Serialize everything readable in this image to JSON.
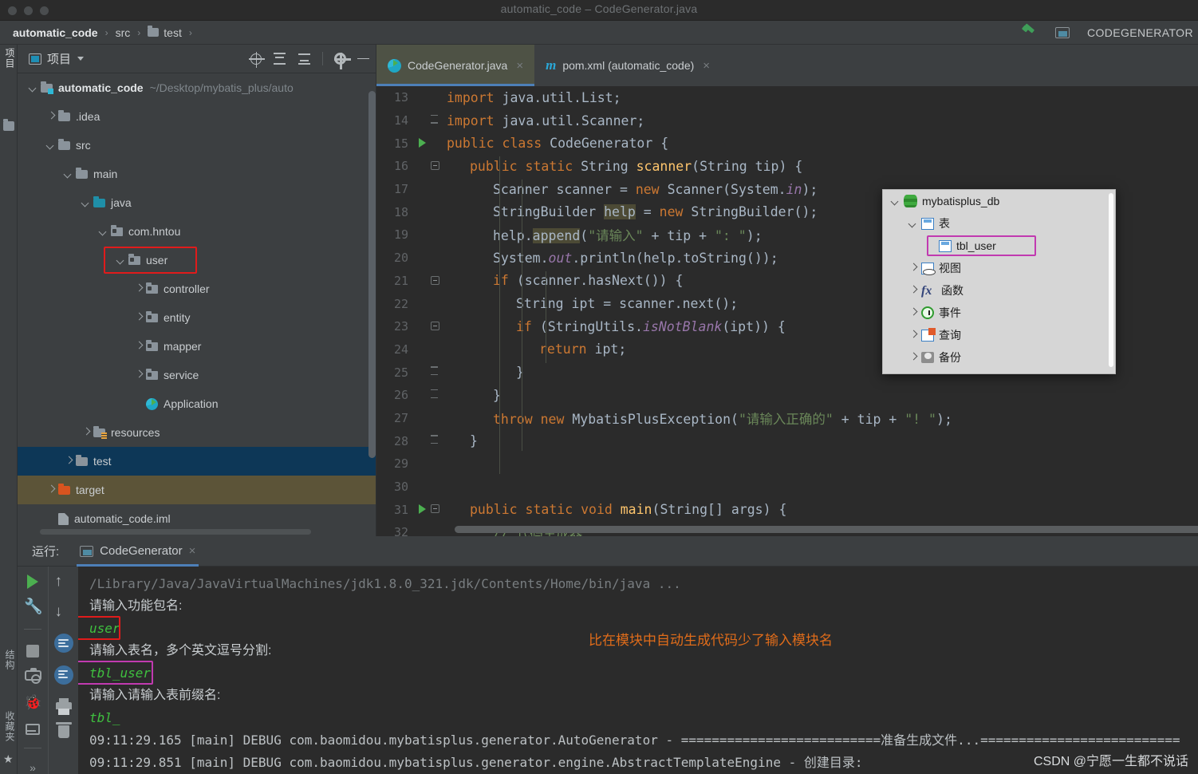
{
  "window": {
    "title": "automatic_code – CodeGenerator.java"
  },
  "navbar": {
    "crumbs": [
      "automatic_code",
      "src",
      "test"
    ],
    "separator": "›",
    "run_config_name": "CODEGENERATOR"
  },
  "left_strip": {
    "project": "项目",
    "structure": "结构",
    "favorites": "收藏夹"
  },
  "project_panel": {
    "title": "项目",
    "tree": [
      {
        "indent": 0,
        "arrow": "down",
        "icon": "folder-module",
        "label": "automatic_code",
        "bold": true,
        "path": "~/Desktop/mybatis_plus/auto"
      },
      {
        "indent": 1,
        "arrow": "right",
        "icon": "folder",
        "label": ".idea"
      },
      {
        "indent": 1,
        "arrow": "down",
        "icon": "folder",
        "label": "src"
      },
      {
        "indent": 2,
        "arrow": "down",
        "icon": "folder",
        "label": "main"
      },
      {
        "indent": 3,
        "arrow": "down",
        "icon": "folder-source",
        "label": "java"
      },
      {
        "indent": 4,
        "arrow": "down",
        "icon": "package",
        "label": "com.hntou"
      },
      {
        "indent": 5,
        "arrow": "down",
        "icon": "package",
        "label": "user",
        "highlight": "red"
      },
      {
        "indent": 6,
        "arrow": "right",
        "icon": "package",
        "label": "controller"
      },
      {
        "indent": 6,
        "arrow": "right",
        "icon": "package",
        "label": "entity"
      },
      {
        "indent": 6,
        "arrow": "right",
        "icon": "package",
        "label": "mapper"
      },
      {
        "indent": 6,
        "arrow": "right",
        "icon": "package",
        "label": "service"
      },
      {
        "indent": 6,
        "arrow": "none",
        "icon": "java-class",
        "label": "Application"
      },
      {
        "indent": 3,
        "arrow": "right",
        "icon": "folder-res",
        "label": "resources"
      },
      {
        "indent": 2,
        "arrow": "right",
        "icon": "folder",
        "label": "test",
        "selected": "blue"
      },
      {
        "indent": 1,
        "arrow": "right",
        "icon": "folder-orange",
        "label": "target",
        "selected": "khaki"
      },
      {
        "indent": 1,
        "arrow": "none",
        "icon": "iml-file",
        "label": "automatic_code.iml"
      }
    ]
  },
  "editor": {
    "tabs": [
      {
        "label": "CodeGenerator.java",
        "icon": "java-class-icon",
        "active": true,
        "close": "×"
      },
      {
        "label": "pom.xml (automatic_code)",
        "icon": "maven-icon",
        "active": false,
        "close": "×"
      }
    ],
    "first_line_number": 13,
    "lines": [
      {
        "n": 13,
        "indent": 0,
        "marker": "",
        "fold": "",
        "tokens": [
          [
            "k",
            "import"
          ],
          [
            "id",
            " java.util.List;"
          ]
        ]
      },
      {
        "n": 14,
        "indent": 0,
        "marker": "",
        "fold": "brace",
        "tokens": [
          [
            "k",
            "import"
          ],
          [
            "id",
            " java.util.Scanner;"
          ]
        ]
      },
      {
        "n": 15,
        "indent": 0,
        "marker": "run",
        "fold": "",
        "tokens": [
          [
            "k",
            "public class "
          ],
          [
            "id",
            "CodeGenerator "
          ],
          [
            "br",
            "{"
          ]
        ]
      },
      {
        "n": 16,
        "indent": 1,
        "marker": "",
        "fold": "minus",
        "tokens": [
          [
            "k",
            "public static "
          ],
          [
            "id",
            "String "
          ],
          [
            "fn",
            "scanner"
          ],
          [
            "br",
            "("
          ],
          [
            "id",
            "String tip"
          ],
          [
            "br",
            ") {"
          ]
        ]
      },
      {
        "n": 17,
        "indent": 2,
        "marker": "",
        "fold": "",
        "tokens": [
          [
            "id",
            "Scanner scanner = "
          ],
          [
            "k",
            "new "
          ],
          [
            "id",
            "Scanner"
          ],
          [
            "br",
            "("
          ],
          [
            "id",
            "System."
          ],
          [
            "st",
            "in"
          ],
          [
            "br",
            ")"
          ],
          [
            "id",
            ";"
          ]
        ]
      },
      {
        "n": 18,
        "indent": 2,
        "marker": "",
        "fold": "",
        "tokens": [
          [
            "id",
            "StringBuilder "
          ],
          [
            "hl",
            "help"
          ],
          [
            "id",
            " = "
          ],
          [
            "k",
            "new "
          ],
          [
            "id",
            "StringBuilder"
          ],
          [
            "br",
            "()"
          ],
          [
            "id",
            ";"
          ]
        ]
      },
      {
        "n": 19,
        "indent": 2,
        "marker": "",
        "fold": "",
        "tokens": [
          [
            "id",
            "help."
          ],
          [
            "hl",
            "append"
          ],
          [
            "br",
            "("
          ],
          [
            "s",
            "\"请输入\""
          ],
          [
            "id",
            " + tip + "
          ],
          [
            "s",
            "\": \""
          ],
          [
            "br",
            ")"
          ],
          [
            "id",
            ";"
          ]
        ]
      },
      {
        "n": 20,
        "indent": 2,
        "marker": "",
        "fold": "",
        "tokens": [
          [
            "id",
            "System."
          ],
          [
            "st",
            "out"
          ],
          [
            "id",
            ".println"
          ],
          [
            "br",
            "("
          ],
          [
            "id",
            "help.toString"
          ],
          [
            "br",
            "())"
          ],
          [
            "id",
            ";"
          ]
        ]
      },
      {
        "n": 21,
        "indent": 2,
        "marker": "",
        "fold": "minus",
        "tokens": [
          [
            "k",
            "if "
          ],
          [
            "br",
            "("
          ],
          [
            "id",
            "scanner.hasNext"
          ],
          [
            "br",
            "()) {"
          ]
        ]
      },
      {
        "n": 22,
        "indent": 3,
        "marker": "",
        "fold": "",
        "tokens": [
          [
            "id",
            "String ipt = scanner.next"
          ],
          [
            "br",
            "()"
          ],
          [
            "id",
            ";"
          ]
        ]
      },
      {
        "n": 23,
        "indent": 3,
        "marker": "",
        "fold": "minus",
        "tokens": [
          [
            "k",
            "if "
          ],
          [
            "br",
            "("
          ],
          [
            "id",
            "StringUtils."
          ],
          [
            "st",
            "isNotBlank"
          ],
          [
            "br",
            "("
          ],
          [
            "id",
            "ipt"
          ],
          [
            "br",
            ")) {"
          ]
        ]
      },
      {
        "n": 24,
        "indent": 4,
        "marker": "",
        "fold": "",
        "tokens": [
          [
            "k",
            "return "
          ],
          [
            "id",
            "ipt;"
          ]
        ]
      },
      {
        "n": 25,
        "indent": 3,
        "marker": "",
        "fold": "brace",
        "tokens": [
          [
            "br",
            "}"
          ]
        ]
      },
      {
        "n": 26,
        "indent": 2,
        "marker": "",
        "fold": "brace",
        "tokens": [
          [
            "br",
            "}"
          ]
        ]
      },
      {
        "n": 27,
        "indent": 2,
        "marker": "",
        "fold": "",
        "tokens": [
          [
            "k",
            "throw new "
          ],
          [
            "id",
            "MybatisPlusException"
          ],
          [
            "br",
            "("
          ],
          [
            "s",
            "\"请输入正确的\""
          ],
          [
            "id",
            " + tip + "
          ],
          [
            "s",
            "\"! \""
          ],
          [
            "br",
            ")"
          ],
          [
            "id",
            ";"
          ]
        ]
      },
      {
        "n": 28,
        "indent": 1,
        "marker": "",
        "fold": "brace",
        "tokens": [
          [
            "br",
            "}"
          ]
        ]
      },
      {
        "n": 29,
        "indent": 0,
        "marker": "",
        "fold": "",
        "tokens": []
      },
      {
        "n": 30,
        "indent": 0,
        "marker": "",
        "fold": "",
        "tokens": []
      },
      {
        "n": 31,
        "indent": 1,
        "marker": "run",
        "fold": "minus",
        "tokens": [
          [
            "k",
            "public static void "
          ],
          [
            "fn",
            "main"
          ],
          [
            "br",
            "("
          ],
          [
            "id",
            "String"
          ],
          [
            "br",
            "[] "
          ],
          [
            "id",
            "args"
          ],
          [
            "br",
            ") {"
          ]
        ]
      },
      {
        "n": 32,
        "indent": 2,
        "marker": "",
        "fold": "",
        "tokens": [
          [
            "s",
            "// 代码生成器"
          ]
        ]
      }
    ]
  },
  "db_popup": {
    "rows": [
      {
        "indent": 0,
        "arrow": "down",
        "icon": "db-icon",
        "label": "mybatisplus_db"
      },
      {
        "indent": 1,
        "arrow": "down",
        "icon": "table-icon",
        "label": "表"
      },
      {
        "indent": 2,
        "arrow": "none",
        "icon": "table-icon",
        "label": "tbl_user",
        "highlight": "magenta"
      },
      {
        "indent": 1,
        "arrow": "right",
        "icon": "view-icon",
        "label": "视图"
      },
      {
        "indent": 1,
        "arrow": "right",
        "icon": "function-icon",
        "label": "函数"
      },
      {
        "indent": 1,
        "arrow": "right",
        "icon": "event-icon",
        "label": "事件"
      },
      {
        "indent": 1,
        "arrow": "right",
        "icon": "query-icon",
        "label": "查询"
      },
      {
        "indent": 1,
        "arrow": "right",
        "icon": "backup-icon",
        "label": "备份"
      }
    ]
  },
  "run_panel": {
    "caption": "运行:",
    "tab_label": "CodeGenerator",
    "tab_close": "×",
    "toolbar_left": [
      "run-icon",
      "wrench-icon",
      "stop-icon",
      "camera-icon",
      "bug-icon",
      "export-icon"
    ],
    "toolbar_right": [
      "up-arrow-icon",
      "down-arrow-icon",
      "soft-wrap-icon",
      "scroll-to-end-icon",
      "print-icon",
      "trash-icon"
    ],
    "more_chevron": "»",
    "console": [
      {
        "style": "dim",
        "text": "/Library/Java/JavaVirtualMachines/jdk1.8.0_321.jdk/Contents/Home/bin/java ..."
      },
      {
        "style": "white",
        "text": "请输入功能包名:"
      },
      {
        "style": "green",
        "text": "user",
        "highlight": "red"
      },
      {
        "style": "white",
        "text": "请输入表名，多个英文逗号分割:"
      },
      {
        "style": "green",
        "text": "tbl_user",
        "highlight": "magenta"
      },
      {
        "style": "white",
        "text": "请输入请输入表前缀名:"
      },
      {
        "style": "green",
        "text": "tbl_"
      },
      {
        "style": "log",
        "text": "09:11:29.165 [main] DEBUG com.baomidou.mybatisplus.generator.AutoGenerator - ==========================准备生成文件...=========================="
      },
      {
        "style": "log",
        "text": "09:11:29.851 [main] DEBUG com.baomidou.mybatisplus.generator.engine.AbstractTemplateEngine - 创建目录:"
      }
    ],
    "annotation": "比在模块中自动生成代码少了输入模块名",
    "watermark": "CSDN @宁愿一生都不说话"
  },
  "colors": {
    "accent_blue": "#4d7fb8",
    "red_box": "#e01b1b",
    "magenta_box": "#c13ab0",
    "green_text": "#3fc13f",
    "orange_note": "#e06c1a"
  }
}
